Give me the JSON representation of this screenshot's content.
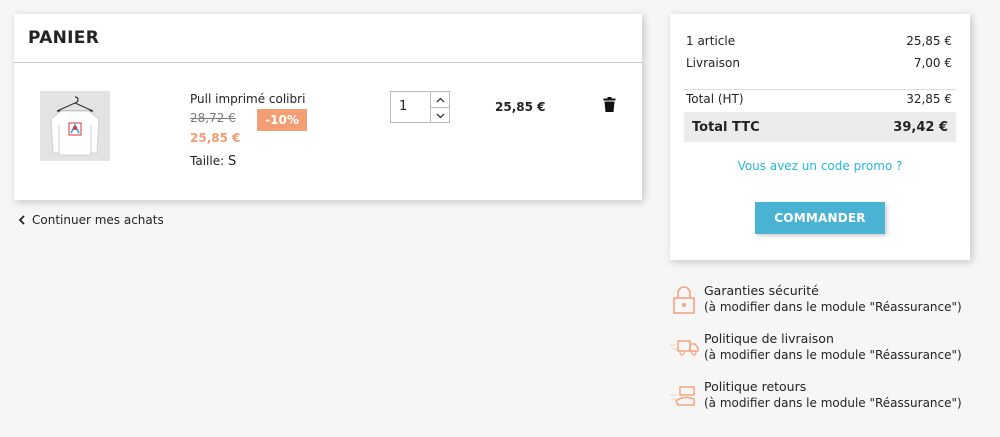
{
  "cart": {
    "title": "PANIER",
    "item": {
      "name": "Pull imprimé colibri",
      "old_price": "28,72 €",
      "discount": "-10%",
      "new_price": "25,85 €",
      "size_label": "Taille:",
      "size_value": "S",
      "quantity": "1",
      "line_total": "25,85 €"
    },
    "continue_label": "Continuer mes achats"
  },
  "summary": {
    "items_label": "1 article",
    "items_value": "25,85 €",
    "shipping_label": "Livraison",
    "shipping_value": "7,00 €",
    "total_ht_label": "Total (HT)",
    "total_ht_value": "32,85 €",
    "total_ttc_label": "Total TTC",
    "total_ttc_value": "39,42 €",
    "promo_label": "Vous avez un code promo ?",
    "checkout_label": "COMMANDER"
  },
  "reassurance": [
    {
      "title": "Garanties sécurité",
      "subtitle": "(à modifier dans le module \"Réassurance\")",
      "icon": "lock-icon"
    },
    {
      "title": "Politique de livraison",
      "subtitle": "(à modifier dans le module \"Réassurance\")",
      "icon": "truck-icon"
    },
    {
      "title": "Politique retours",
      "subtitle": "(à modifier dans le module \"Réassurance\")",
      "icon": "return-box-icon"
    }
  ],
  "colors": {
    "accent": "#24b9d7",
    "discount": "#f39d72",
    "icon_orange": "#f3a57d"
  }
}
